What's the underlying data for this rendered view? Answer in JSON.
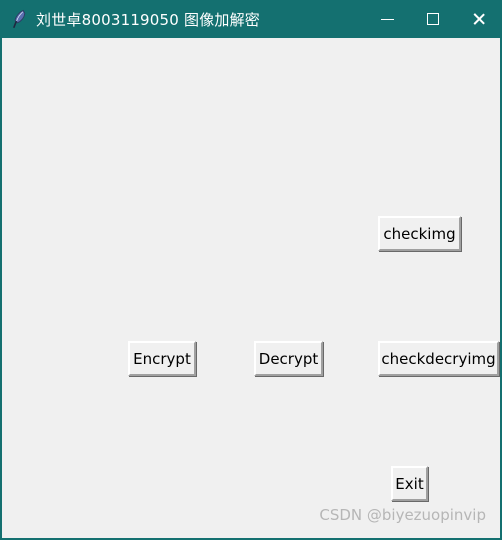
{
  "window": {
    "title": "刘世卓8003119050 图像加解密",
    "icon": "feather-quill-icon",
    "titlebar_color": "#147070",
    "client_background": "#f0f0f0",
    "border_color": "#147070",
    "controls": {
      "minimize_label": "—",
      "maximize_label": "□",
      "close_label": "✕",
      "minimize_name": "minimize",
      "maximize_name": "maximize",
      "close_name": "close"
    }
  },
  "main": {
    "buttons": [
      {
        "id": "checkimg",
        "label": "checkimg"
      },
      {
        "id": "encrypt",
        "label": "Encrypt"
      },
      {
        "id": "decrypt",
        "label": "Decrypt"
      },
      {
        "id": "checkdecryimg",
        "label": "checkdecryimg"
      },
      {
        "id": "exit",
        "label": "Exit"
      }
    ]
  },
  "watermark": {
    "text": "CSDN @biyezuopinvip",
    "color": "#b6b6b6"
  }
}
